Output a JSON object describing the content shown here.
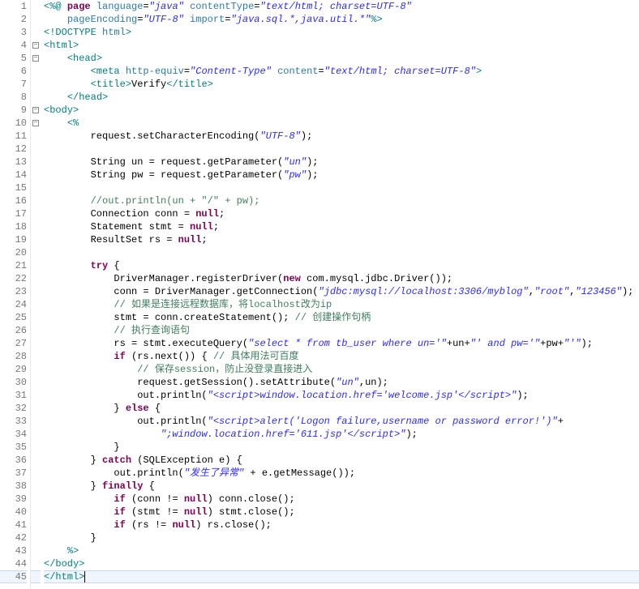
{
  "lines": [
    {
      "num": "1",
      "fold": "",
      "segments": [
        {
          "cls": "t",
          "t": "<%@ "
        },
        {
          "cls": "k",
          "t": "page "
        },
        {
          "cls": "a",
          "t": "language"
        },
        {
          "cls": "p",
          "t": "="
        },
        {
          "cls": "s",
          "t": "\"java\" "
        },
        {
          "cls": "a",
          "t": "contentType"
        },
        {
          "cls": "p",
          "t": "="
        },
        {
          "cls": "s",
          "t": "\"text/html; charset=UTF-8\""
        }
      ]
    },
    {
      "num": "2",
      "fold": "",
      "segments": [
        {
          "cls": "p",
          "t": "    "
        },
        {
          "cls": "a",
          "t": "pageEncoding"
        },
        {
          "cls": "p",
          "t": "="
        },
        {
          "cls": "s",
          "t": "\"UTF-8\" "
        },
        {
          "cls": "a",
          "t": "import"
        },
        {
          "cls": "p",
          "t": "="
        },
        {
          "cls": "s",
          "t": "\"java.sql.*,java.util.*\""
        },
        {
          "cls": "t",
          "t": "%>"
        }
      ]
    },
    {
      "num": "3",
      "fold": "",
      "segments": [
        {
          "cls": "t",
          "t": "<!DOCTYPE "
        },
        {
          "cls": "a",
          "t": "html"
        },
        {
          "cls": "t",
          "t": ">"
        }
      ]
    },
    {
      "num": "4",
      "fold": "minus",
      "segments": [
        {
          "cls": "t",
          "t": "<html>"
        }
      ]
    },
    {
      "num": "5",
      "fold": "minus",
      "segments": [
        {
          "cls": "p",
          "t": "    "
        },
        {
          "cls": "t",
          "t": "<head>"
        }
      ]
    },
    {
      "num": "6",
      "fold": "",
      "segments": [
        {
          "cls": "p",
          "t": "        "
        },
        {
          "cls": "t",
          "t": "<meta "
        },
        {
          "cls": "a",
          "t": "http-equiv"
        },
        {
          "cls": "p",
          "t": "="
        },
        {
          "cls": "s",
          "t": "\"Content-Type\" "
        },
        {
          "cls": "a",
          "t": "content"
        },
        {
          "cls": "p",
          "t": "="
        },
        {
          "cls": "s",
          "t": "\"text/html; charset=UTF-8\""
        },
        {
          "cls": "t",
          "t": ">"
        }
      ]
    },
    {
      "num": "7",
      "fold": "",
      "segments": [
        {
          "cls": "p",
          "t": "        "
        },
        {
          "cls": "t",
          "t": "<title>"
        },
        {
          "cls": "p",
          "t": "Verify"
        },
        {
          "cls": "t",
          "t": "</title>"
        }
      ]
    },
    {
      "num": "8",
      "fold": "",
      "segments": [
        {
          "cls": "p",
          "t": "    "
        },
        {
          "cls": "t",
          "t": "</head>"
        }
      ]
    },
    {
      "num": "9",
      "fold": "minus",
      "segments": [
        {
          "cls": "t",
          "t": "<body>"
        }
      ]
    },
    {
      "num": "10",
      "fold": "minus",
      "segments": [
        {
          "cls": "p",
          "t": "    "
        },
        {
          "cls": "t",
          "t": "<%"
        }
      ]
    },
    {
      "num": "11",
      "fold": "",
      "segments": [
        {
          "cls": "p",
          "t": "        request.setCharacterEncoding("
        },
        {
          "cls": "s",
          "t": "\"UTF-8\""
        },
        {
          "cls": "p",
          "t": ");"
        }
      ]
    },
    {
      "num": "12",
      "fold": "",
      "segments": [
        {
          "cls": "p",
          "t": ""
        }
      ]
    },
    {
      "num": "13",
      "fold": "",
      "segments": [
        {
          "cls": "p",
          "t": "        String un = request.getParameter("
        },
        {
          "cls": "s",
          "t": "\"un\""
        },
        {
          "cls": "p",
          "t": ");"
        }
      ]
    },
    {
      "num": "14",
      "fold": "",
      "segments": [
        {
          "cls": "p",
          "t": "        String pw = request.getParameter("
        },
        {
          "cls": "s",
          "t": "\"pw\""
        },
        {
          "cls": "p",
          "t": ");"
        }
      ]
    },
    {
      "num": "15",
      "fold": "",
      "segments": [
        {
          "cls": "p",
          "t": ""
        }
      ]
    },
    {
      "num": "16",
      "fold": "",
      "segments": [
        {
          "cls": "p",
          "t": "        "
        },
        {
          "cls": "c",
          "t": "//out.println(un + \"/\" + pw);"
        }
      ]
    },
    {
      "num": "17",
      "fold": "",
      "segments": [
        {
          "cls": "p",
          "t": "        Connection conn = "
        },
        {
          "cls": "k",
          "t": "null"
        },
        {
          "cls": "p",
          "t": ";"
        }
      ]
    },
    {
      "num": "18",
      "fold": "",
      "segments": [
        {
          "cls": "p",
          "t": "        Statement stmt = "
        },
        {
          "cls": "k",
          "t": "null"
        },
        {
          "cls": "p",
          "t": ";"
        }
      ]
    },
    {
      "num": "19",
      "fold": "",
      "segments": [
        {
          "cls": "p",
          "t": "        ResultSet rs = "
        },
        {
          "cls": "k",
          "t": "null"
        },
        {
          "cls": "p",
          "t": ";"
        }
      ]
    },
    {
      "num": "20",
      "fold": "",
      "segments": [
        {
          "cls": "p",
          "t": ""
        }
      ]
    },
    {
      "num": "21",
      "fold": "",
      "segments": [
        {
          "cls": "p",
          "t": "        "
        },
        {
          "cls": "k",
          "t": "try"
        },
        {
          "cls": "p",
          "t": " {"
        }
      ]
    },
    {
      "num": "22",
      "fold": "",
      "segments": [
        {
          "cls": "p",
          "t": "            DriverManager.registerDriver("
        },
        {
          "cls": "k",
          "t": "new"
        },
        {
          "cls": "p",
          "t": " com.mysql.jdbc.Driver());"
        }
      ]
    },
    {
      "num": "23",
      "fold": "",
      "segments": [
        {
          "cls": "p",
          "t": "            conn = DriverManager.getConnection("
        },
        {
          "cls": "s",
          "t": "\"jdbc:mysql://localhost:3306/myblog\""
        },
        {
          "cls": "p",
          "t": ","
        },
        {
          "cls": "s",
          "t": "\"root\""
        },
        {
          "cls": "p",
          "t": ","
        },
        {
          "cls": "s",
          "t": "\"123456\""
        },
        {
          "cls": "p",
          "t": ");"
        }
      ]
    },
    {
      "num": "24",
      "fold": "",
      "segments": [
        {
          "cls": "p",
          "t": "            "
        },
        {
          "cls": "c",
          "t": "// 如果是连接远程数据库，将localhost改为ip"
        }
      ]
    },
    {
      "num": "25",
      "fold": "",
      "segments": [
        {
          "cls": "p",
          "t": "            stmt = conn.createStatement(); "
        },
        {
          "cls": "c",
          "t": "// 创建操作句柄"
        }
      ]
    },
    {
      "num": "26",
      "fold": "",
      "segments": [
        {
          "cls": "p",
          "t": "            "
        },
        {
          "cls": "c",
          "t": "// 执行查询语句"
        }
      ]
    },
    {
      "num": "27",
      "fold": "",
      "segments": [
        {
          "cls": "p",
          "t": "            rs = stmt.executeQuery("
        },
        {
          "cls": "s",
          "t": "\"select * from tb_user where un='\""
        },
        {
          "cls": "p",
          "t": "+un+"
        },
        {
          "cls": "s",
          "t": "\"' and pw='\""
        },
        {
          "cls": "p",
          "t": "+pw+"
        },
        {
          "cls": "s",
          "t": "\"'\""
        },
        {
          "cls": "p",
          "t": ");"
        }
      ]
    },
    {
      "num": "28",
      "fold": "",
      "segments": [
        {
          "cls": "p",
          "t": "            "
        },
        {
          "cls": "k",
          "t": "if"
        },
        {
          "cls": "p",
          "t": " (rs.next()) { "
        },
        {
          "cls": "c",
          "t": "// 具体用法可百度"
        }
      ]
    },
    {
      "num": "29",
      "fold": "",
      "segments": [
        {
          "cls": "p",
          "t": "                "
        },
        {
          "cls": "c",
          "t": "// 保存session，防止没登录直接进入"
        }
      ]
    },
    {
      "num": "30",
      "fold": "",
      "segments": [
        {
          "cls": "p",
          "t": "                request.getSession().setAttribute("
        },
        {
          "cls": "s",
          "t": "\"un\""
        },
        {
          "cls": "p",
          "t": ",un);"
        }
      ]
    },
    {
      "num": "31",
      "fold": "",
      "segments": [
        {
          "cls": "p",
          "t": "                out.println("
        },
        {
          "cls": "s",
          "t": "\"<script>window.location.href='welcome.jsp'</script>\""
        },
        {
          "cls": "p",
          "t": ");"
        }
      ]
    },
    {
      "num": "32",
      "fold": "",
      "segments": [
        {
          "cls": "p",
          "t": "            } "
        },
        {
          "cls": "k",
          "t": "else"
        },
        {
          "cls": "p",
          "t": " {"
        }
      ]
    },
    {
      "num": "33",
      "fold": "",
      "segments": [
        {
          "cls": "p",
          "t": "                out.println("
        },
        {
          "cls": "s",
          "t": "\"<script>alert('Logon failure,username or password error!')\""
        },
        {
          "cls": "p",
          "t": "+"
        }
      ]
    },
    {
      "num": "34",
      "fold": "",
      "segments": [
        {
          "cls": "p",
          "t": "                    "
        },
        {
          "cls": "s",
          "t": "\";window.location.href='611.jsp'</script>\""
        },
        {
          "cls": "p",
          "t": ");"
        }
      ]
    },
    {
      "num": "35",
      "fold": "",
      "segments": [
        {
          "cls": "p",
          "t": "            }"
        }
      ]
    },
    {
      "num": "36",
      "fold": "",
      "segments": [
        {
          "cls": "p",
          "t": "        } "
        },
        {
          "cls": "k",
          "t": "catch"
        },
        {
          "cls": "p",
          "t": " (SQLException e) {"
        }
      ]
    },
    {
      "num": "37",
      "fold": "",
      "segments": [
        {
          "cls": "p",
          "t": "            out.println("
        },
        {
          "cls": "s",
          "t": "\"发生了异常\""
        },
        {
          "cls": "p",
          "t": " + e.getMessage());"
        }
      ]
    },
    {
      "num": "38",
      "fold": "",
      "segments": [
        {
          "cls": "p",
          "t": "        } "
        },
        {
          "cls": "k",
          "t": "finally"
        },
        {
          "cls": "p",
          "t": " {"
        }
      ]
    },
    {
      "num": "39",
      "fold": "",
      "segments": [
        {
          "cls": "p",
          "t": "            "
        },
        {
          "cls": "k",
          "t": "if"
        },
        {
          "cls": "p",
          "t": " (conn != "
        },
        {
          "cls": "k",
          "t": "null"
        },
        {
          "cls": "p",
          "t": ") conn.close();"
        }
      ]
    },
    {
      "num": "40",
      "fold": "",
      "segments": [
        {
          "cls": "p",
          "t": "            "
        },
        {
          "cls": "k",
          "t": "if"
        },
        {
          "cls": "p",
          "t": " (stmt != "
        },
        {
          "cls": "k",
          "t": "null"
        },
        {
          "cls": "p",
          "t": ") stmt.close();"
        }
      ]
    },
    {
      "num": "41",
      "fold": "",
      "segments": [
        {
          "cls": "p",
          "t": "            "
        },
        {
          "cls": "k",
          "t": "if"
        },
        {
          "cls": "p",
          "t": " (rs != "
        },
        {
          "cls": "k",
          "t": "null"
        },
        {
          "cls": "p",
          "t": ") rs.close();"
        }
      ]
    },
    {
      "num": "42",
      "fold": "",
      "segments": [
        {
          "cls": "p",
          "t": "        }"
        }
      ]
    },
    {
      "num": "43",
      "fold": "",
      "segments": [
        {
          "cls": "p",
          "t": "    "
        },
        {
          "cls": "t",
          "t": "%>"
        }
      ]
    },
    {
      "num": "44",
      "fold": "",
      "segments": [
        {
          "cls": "t",
          "t": "</body>"
        }
      ]
    },
    {
      "num": "45",
      "fold": "",
      "caret_line": true,
      "segments": [
        {
          "cls": "t",
          "t": "</html>"
        }
      ]
    }
  ]
}
